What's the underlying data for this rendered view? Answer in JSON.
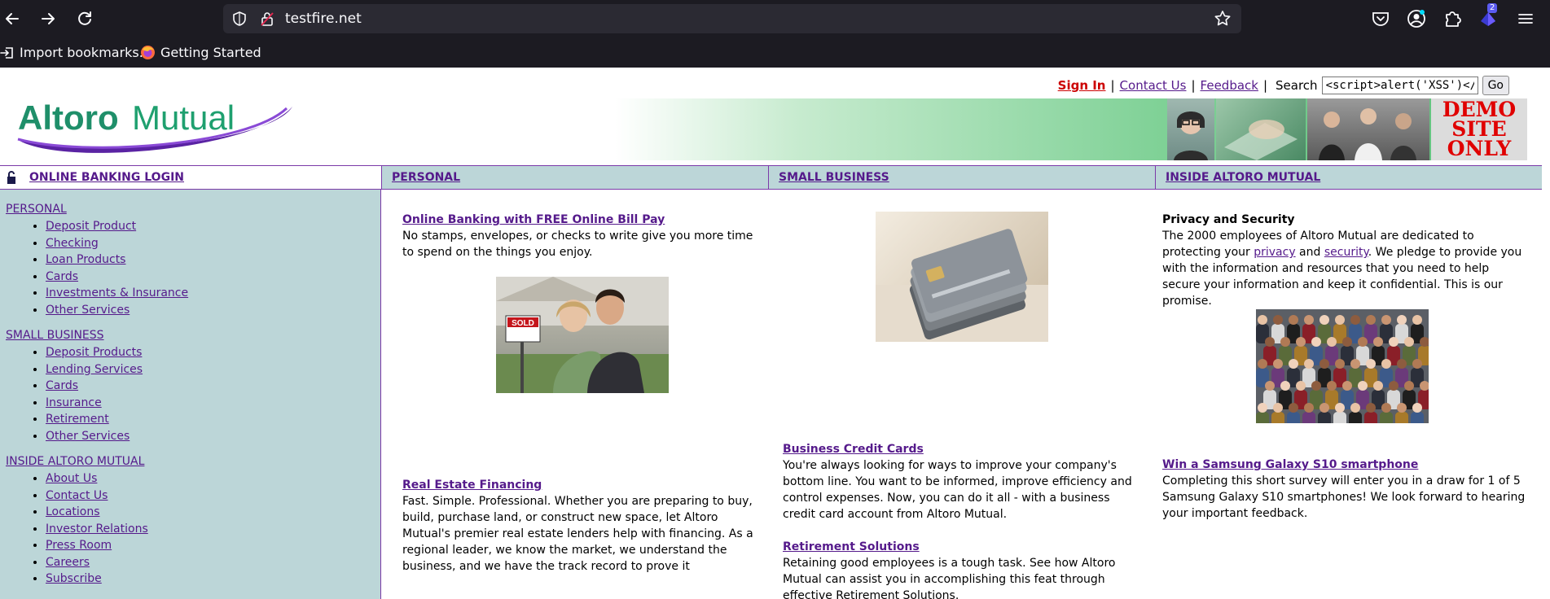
{
  "browser": {
    "url": "testfire.net",
    "extension_badge": "2",
    "bookmarks": [
      {
        "label": "Import bookmarks..."
      },
      {
        "label": "Getting Started"
      }
    ]
  },
  "header": {
    "sign_in": "Sign In",
    "contact_us": "Contact Us",
    "feedback": "Feedback",
    "search_label": "Search",
    "search_value": "<script>alert('XSS')</scrip",
    "go_button": "Go",
    "logo_text_1": "Altoro",
    "logo_text_2": "Mutual",
    "demo_line1": "DEMO",
    "demo_line2": "SITE",
    "demo_line3": "ONLY"
  },
  "tabs": {
    "login": "ONLINE BANKING LOGIN",
    "personal": "PERSONAL",
    "small_business": "SMALL BUSINESS",
    "inside": "INSIDE ALTORO MUTUAL"
  },
  "sidebar": {
    "personal": {
      "title": "PERSONAL",
      "items": [
        "Deposit Product",
        "Checking",
        "Loan Products",
        "Cards",
        "Investments & Insurance",
        "Other Services"
      ]
    },
    "small_business": {
      "title": "SMALL BUSINESS",
      "items": [
        "Deposit Products",
        "Lending Services",
        "Cards",
        "Insurance",
        "Retirement",
        "Other Services"
      ]
    },
    "inside": {
      "title": "INSIDE ALTORO MUTUAL",
      "items": [
        "About Us",
        "Contact Us",
        "Locations",
        "Investor Relations",
        "Press Room",
        "Careers",
        "Subscribe"
      ]
    }
  },
  "content": {
    "col1": {
      "h1": "Online Banking with FREE Online Bill Pay",
      "p1": "No stamps, envelopes, or checks to write give you more time to spend on the things you enjoy.",
      "sold_sign": "SOLD",
      "h2": "Real Estate Financing",
      "p2": "Fast. Simple. Professional. Whether you are preparing to buy, build, purchase land, or construct new space, let Altoro Mutual's premier real estate lenders help with financing. As a regional leader, we know the market, we understand the business, and we have the track record to prove it"
    },
    "col2": {
      "h1": "Business Credit Cards",
      "p1": "You're always looking for ways to improve your company's bottom line. You want to be informed, improve efficiency and control expenses. Now, you can do it all - with a business credit card account from Altoro Mutual.",
      "h2": "Retirement Solutions",
      "p2": "Retaining good employees is a tough task. See how Altoro Mutual can assist you in accomplishing this feat through effective Retirement Solutions."
    },
    "col3": {
      "h1": "Privacy and Security",
      "p1_a": "The 2000 employees of Altoro Mutual are dedicated to protecting your ",
      "privacy": "privacy",
      "p1_b": " and ",
      "security": "security",
      "p1_c": ". We pledge to provide you with the information and resources that you need to help secure your information and keep it confidential. This is our promise.",
      "h2": "Win a Samsung Galaxy S10 smartphone",
      "p2": "Completing this short survey will enter you in a draw for 1 of 5 Samsung Galaxy S10 smartphones! We look forward to hearing your important feedback."
    }
  }
}
